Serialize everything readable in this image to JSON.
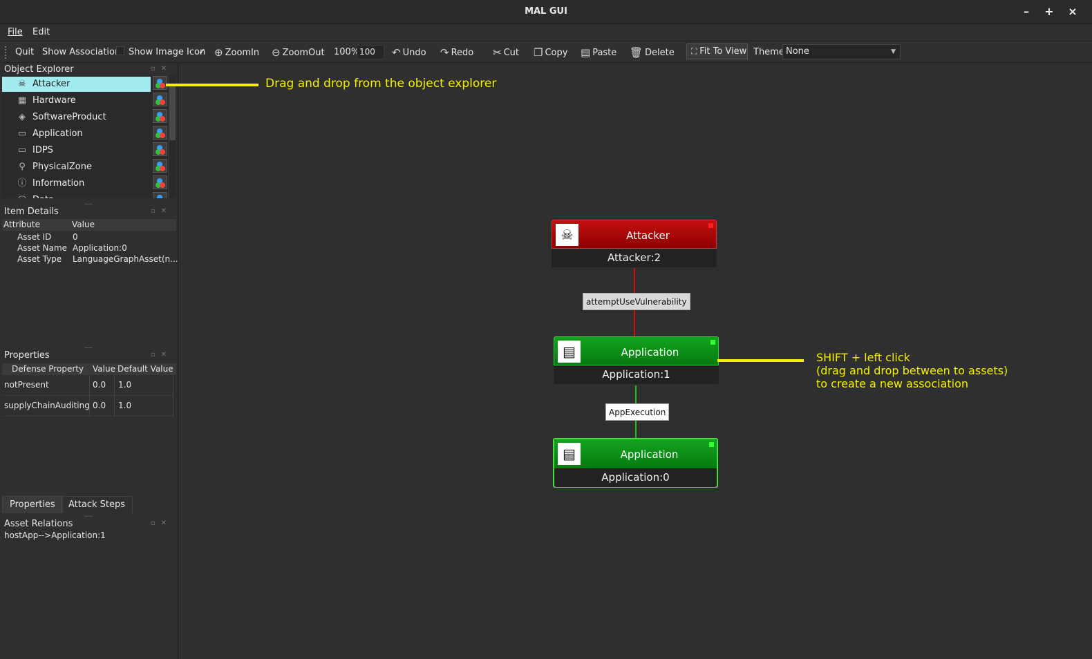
{
  "window": {
    "title": "MAL GUI",
    "minimize": "–",
    "maximize": "+",
    "close": "×"
  },
  "menubar": {
    "file": "File",
    "edit": "Edit"
  },
  "toolbar": {
    "quit": "Quit",
    "show_association": "Show Association",
    "show_image_icon": "Show Image Icon",
    "show_image_icon_check": "✓",
    "zoom_in": "ZoomIn",
    "zoom_out": "ZoomOut",
    "zoom_percent": "100%",
    "zoom_value": "100",
    "undo": "Undo",
    "redo": "Redo",
    "cut": "Cut",
    "copy": "Copy",
    "paste": "Paste",
    "delete": "Delete",
    "fit_to_view": "Fit To View",
    "theme_label": "Theme",
    "theme_value": "None"
  },
  "object_explorer": {
    "title": "Object Explorer",
    "items": [
      {
        "label": "Attacker",
        "icon": "attacker-icon",
        "selected": true
      },
      {
        "label": "Hardware",
        "icon": "hardware-icon"
      },
      {
        "label": "SoftwareProduct",
        "icon": "software-product-icon"
      },
      {
        "label": "Application",
        "icon": "application-icon"
      },
      {
        "label": "IDPS",
        "icon": "idps-icon"
      },
      {
        "label": "PhysicalZone",
        "icon": "physical-zone-icon"
      },
      {
        "label": "Information",
        "icon": "information-icon"
      },
      {
        "label": "Data",
        "icon": "data-icon"
      }
    ]
  },
  "item_details": {
    "title": "Item Details",
    "col_attribute": "Attribute",
    "col_value": "Value",
    "rows": [
      {
        "attr": "Asset ID",
        "value": "0"
      },
      {
        "attr": "Asset Name",
        "value": "Application:0"
      },
      {
        "attr": "Asset Type",
        "value": "LanguageGraphAsset(n..."
      }
    ]
  },
  "properties": {
    "title": "Properties",
    "col_property": "Defense Property",
    "col_value": "Value",
    "col_default": "Default Value",
    "rows": [
      {
        "name": "notPresent",
        "value": "0.0",
        "default": "1.0"
      },
      {
        "name": "supplyChainAuditing",
        "value": "0.0",
        "default": "1.0"
      }
    ]
  },
  "tabs": {
    "properties": "Properties",
    "attack_steps": "Attack Steps"
  },
  "asset_relations": {
    "title": "Asset Relations",
    "items": [
      "hostApp-->Application:1"
    ]
  },
  "canvas": {
    "nodes": [
      {
        "type": "Attacker",
        "name": "Attacker:2",
        "icon": "attacker-icon",
        "color": "#b00000",
        "status": "#ff2020"
      },
      {
        "type": "Application",
        "name": "Application:1",
        "icon": "application-icon",
        "color": "#0a8a14",
        "status": "#30ff30"
      },
      {
        "type": "Application",
        "name": "Application:0",
        "icon": "application-icon",
        "color": "#0a8a14",
        "status": "#30ff30"
      }
    ],
    "edges": [
      {
        "label": "attemptUseVulnerability",
        "color": "#d01010"
      },
      {
        "label": "AppExecution",
        "color": "#20c020"
      }
    ]
  },
  "annotations": {
    "drag_drop": "Drag and drop from the object explorer",
    "shift_line1": "SHIFT + left click",
    "shift_line2": "(drag and drop between to assets)",
    "shift_line3": "to create a new association",
    "color": "#f5f000"
  }
}
